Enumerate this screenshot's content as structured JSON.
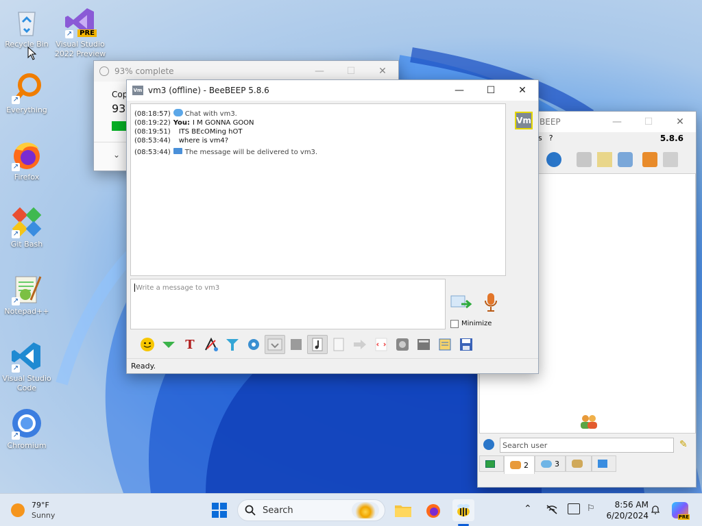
{
  "desktop": {
    "icons": [
      {
        "label": "Recycle Bin"
      },
      {
        "label": "Visual Studio 2022 Preview",
        "badge": "PRE"
      },
      {
        "label": "Everything"
      },
      {
        "label": "Firefox"
      },
      {
        "label": "Git Bash"
      },
      {
        "label": "Notepad++"
      },
      {
        "label": "Visual Studio Code"
      },
      {
        "label": "Chromium"
      }
    ]
  },
  "progress_window": {
    "title": "93% complete",
    "line1": "Cop",
    "percent": "93",
    "progress_value": 0.93
  },
  "chat_window": {
    "title": "vm3 (offline) - BeeBEEP 5.8.6",
    "avatar_initials": "Vm",
    "messages": [
      {
        "time": "(08:18:57)",
        "author": "",
        "text": "Chat with vm3.",
        "kind": "system"
      },
      {
        "time": "(08:19:22)",
        "author": "You:",
        "text": "I M GONNA GOON",
        "kind": "user"
      },
      {
        "time": "(08:19:51)",
        "author": "",
        "text": "ITS BEcOMing hOT",
        "kind": "user"
      },
      {
        "time": "(08:53:44)",
        "author": "",
        "text": "where is vm4?",
        "kind": "user"
      },
      {
        "time": "(08:53:44)",
        "author": "",
        "text": "The message will be delivered to vm3.",
        "kind": "envelope"
      }
    ],
    "input_placeholder": "Write a message to vm3",
    "minimize_label": "Minimize",
    "status": "Ready."
  },
  "bee_main": {
    "title": "BEEP",
    "menu_help": "?",
    "menu_partial": "s",
    "version": "5.8.6",
    "search_placeholder": "Search user",
    "tabs": [
      {
        "label": "",
        "icon": "chat-tab-icon"
      },
      {
        "label": "2",
        "icon": "users-icon"
      },
      {
        "label": "3",
        "icon": "chats-icon"
      },
      {
        "label": "",
        "icon": "groups-icon"
      },
      {
        "label": "",
        "icon": "share-icon"
      }
    ]
  },
  "taskbar": {
    "weather_temp": "79°F",
    "weather_desc": "Sunny",
    "search_label": "Search",
    "time": "8:56 AM",
    "date": "6/20/2024"
  },
  "colors": {
    "accent": "#0b5cd6",
    "progress_green": "#06b025",
    "avatar_border": "#e6d800"
  }
}
